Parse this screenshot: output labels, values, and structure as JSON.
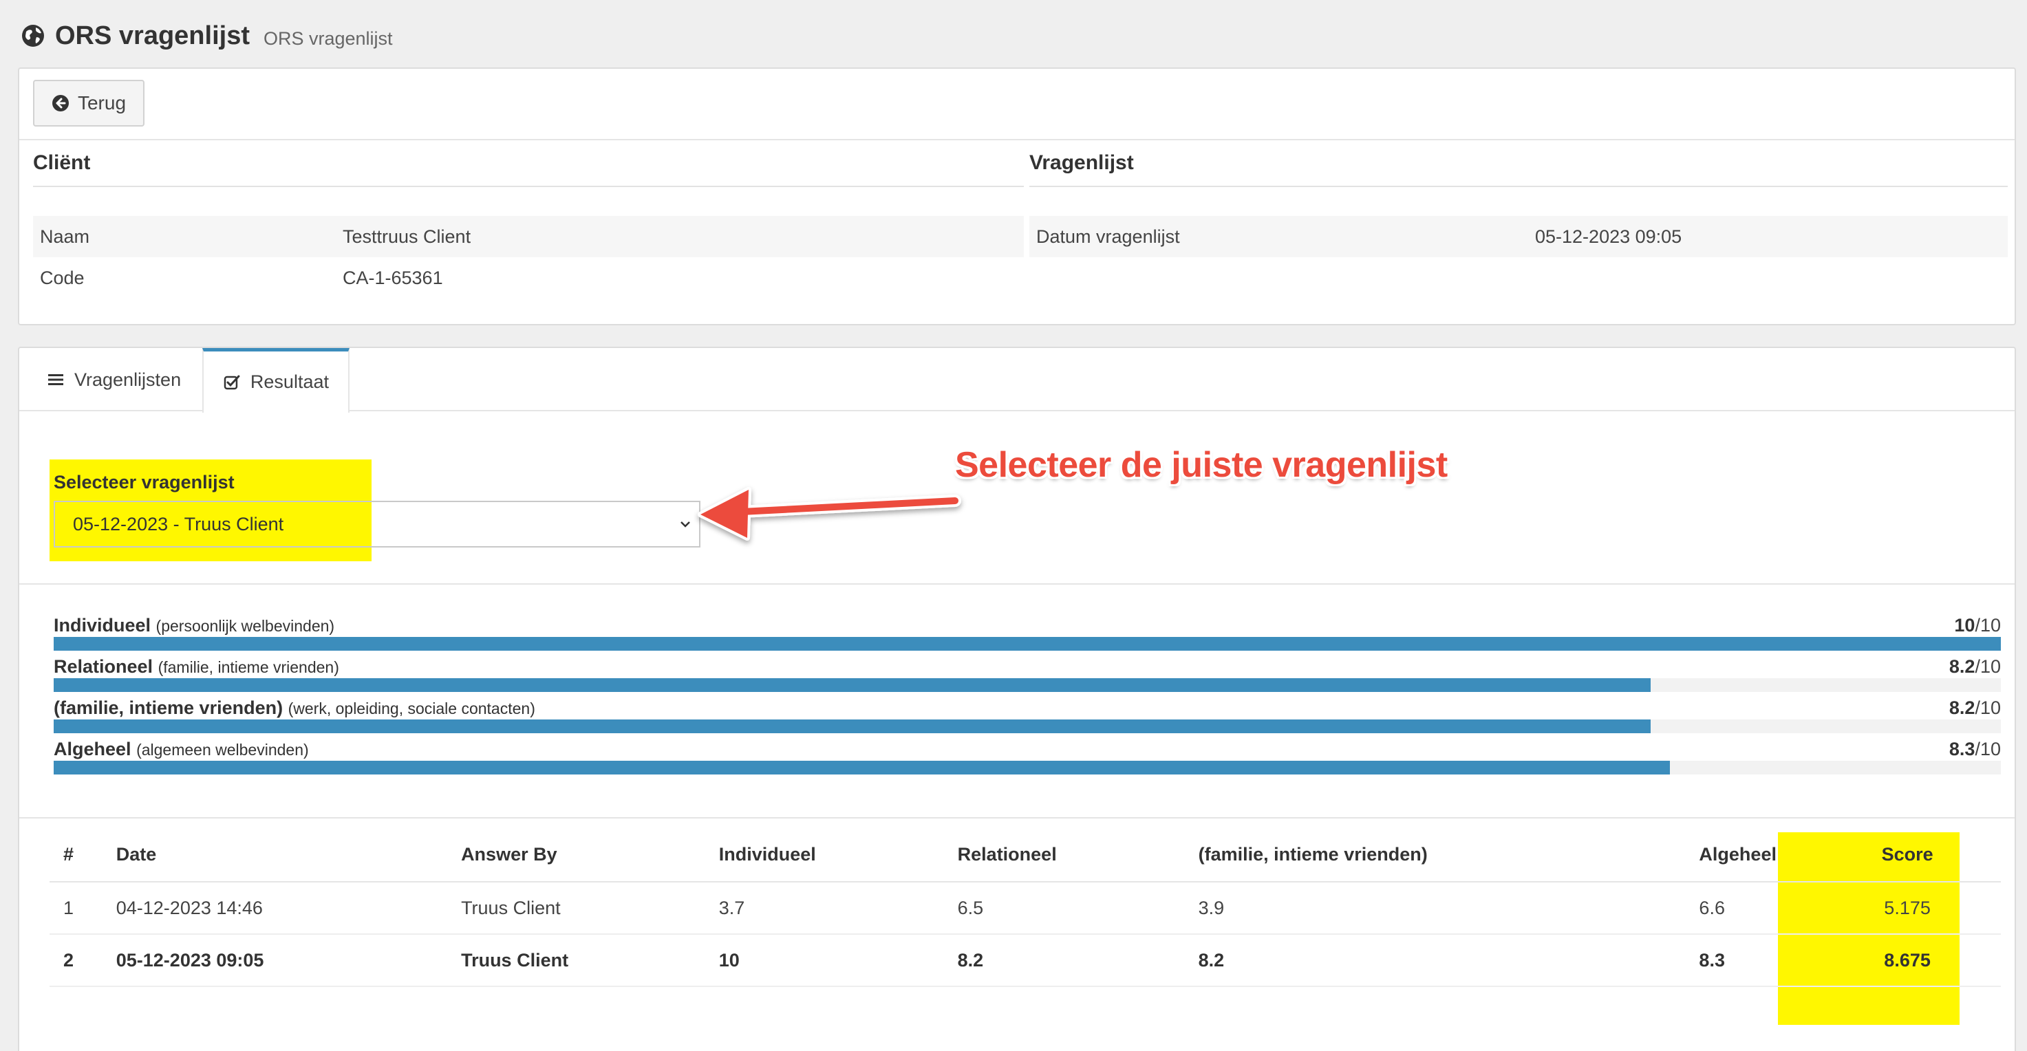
{
  "header": {
    "title": "ORS vragenlijst",
    "subtitle": "ORS vragenlijst"
  },
  "back_button": {
    "label": "Terug"
  },
  "client": {
    "heading": "Cliënt",
    "rows": [
      {
        "label": "Naam",
        "value": "Testtruus Client"
      },
      {
        "label": "Code",
        "value": "CA-1-65361"
      }
    ]
  },
  "questionnaire": {
    "heading": "Vragenlijst",
    "rows": [
      {
        "label": "Datum vragenlijst",
        "value": "05-12-2023 09:05"
      }
    ]
  },
  "tabs": [
    {
      "label": "Vragenlijsten",
      "icon": "list-icon",
      "active": false
    },
    {
      "label": "Resultaat",
      "icon": "check-square-icon",
      "active": true
    }
  ],
  "select": {
    "label": "Selecteer vragenlijst",
    "value": "05-12-2023 - Truus Client"
  },
  "annotation": {
    "text": "Selecteer de juiste vragenlijst"
  },
  "scores": [
    {
      "label": "Individueel",
      "sub": "(persoonlijk welbevinden)",
      "value": "10",
      "max": "/10",
      "fraction": 1.0
    },
    {
      "label": "Relationeel",
      "sub": "(familie, intieme vrienden)",
      "value": "8.2",
      "max": "/10",
      "fraction": 0.82
    },
    {
      "label": "(familie, intieme vrienden)",
      "sub": "(werk, opleiding, sociale contacten)",
      "value": "8.2",
      "max": "/10",
      "fraction": 0.82
    },
    {
      "label": "Algeheel",
      "sub": "(algemeen welbevinden)",
      "value": "8.3",
      "max": "/10",
      "fraction": 0.83
    }
  ],
  "table": {
    "headers": [
      "#",
      "Date",
      "Answer By",
      "Individueel",
      "Relationeel",
      "(familie, intieme vrienden)",
      "Algeheel",
      "Score"
    ],
    "rows": [
      [
        "1",
        "04-12-2023 14:46",
        "Truus Client",
        "3.7",
        "6.5",
        "3.9",
        "6.6",
        "5.175"
      ],
      [
        "2",
        "05-12-2023 09:05",
        "Truus Client",
        "10",
        "8.2",
        "8.2",
        "8.3",
        "8.675"
      ]
    ]
  },
  "colors": {
    "accent": "#3c8dbc",
    "highlight": "#fff700",
    "annotation": "#ec4b3c"
  }
}
